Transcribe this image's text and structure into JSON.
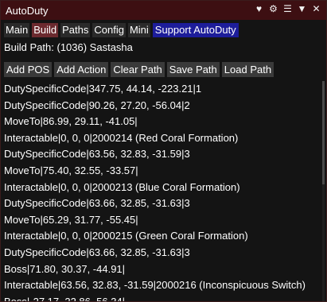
{
  "window": {
    "title": "AutoDuty",
    "icons": [
      "heart-icon",
      "gear-icon",
      "menu-icon",
      "collapse-icon",
      "close-icon"
    ],
    "icon_glyphs": {
      "heart": "♥",
      "gear": "⚙",
      "menu": "☰",
      "collapse": "▼",
      "close": "✕"
    }
  },
  "tabs": [
    {
      "label": "Main"
    },
    {
      "label": "Build"
    },
    {
      "label": "Paths"
    },
    {
      "label": "Config"
    },
    {
      "label": "Mini"
    },
    {
      "label": "Support AutoDuty"
    }
  ],
  "build": {
    "path_label": "Build Path: (1036) Sastasha"
  },
  "toolbar": {
    "add_pos": "Add POS",
    "add_action": "Add Action",
    "clear_path": "Clear Path",
    "save_path": "Save Path",
    "load_path": "Load Path"
  },
  "path_entries": [
    "DutySpecificCode|347.75, 44.14, -223.21|1",
    "DutySpecificCode|90.26, 27.20, -56.04|2",
    "MoveTo|86.99, 29.11, -41.05|",
    "Interactable|0, 0, 0|2000214 (Red Coral Formation)",
    "DutySpecificCode|63.56, 32.83, -31.59|3",
    "MoveTo|75.40, 32.55, -33.57|",
    "Interactable|0, 0, 0|2000213 (Blue Coral Formation)",
    "DutySpecificCode|63.66, 32.85, -31.63|3",
    "MoveTo|65.29, 31.77, -55.45|",
    "Interactable|0, 0, 0|2000215 (Green Coral Formation)",
    "DutySpecificCode|63.66, 32.85, -31.63|3",
    "Boss|71.80, 30.37, -44.91|",
    "Interactable|63.56, 32.83, -31.59|2000216 (Inconspicuous Switch)",
    "Boss|-27.17, 22.86, 56.34|"
  ],
  "colors": {
    "titlebar": "#3d0f12",
    "active_tab": "#6b2a2f",
    "support_tab": "#1d1d9a",
    "button": "#3a3a3a",
    "background": "#141414"
  }
}
